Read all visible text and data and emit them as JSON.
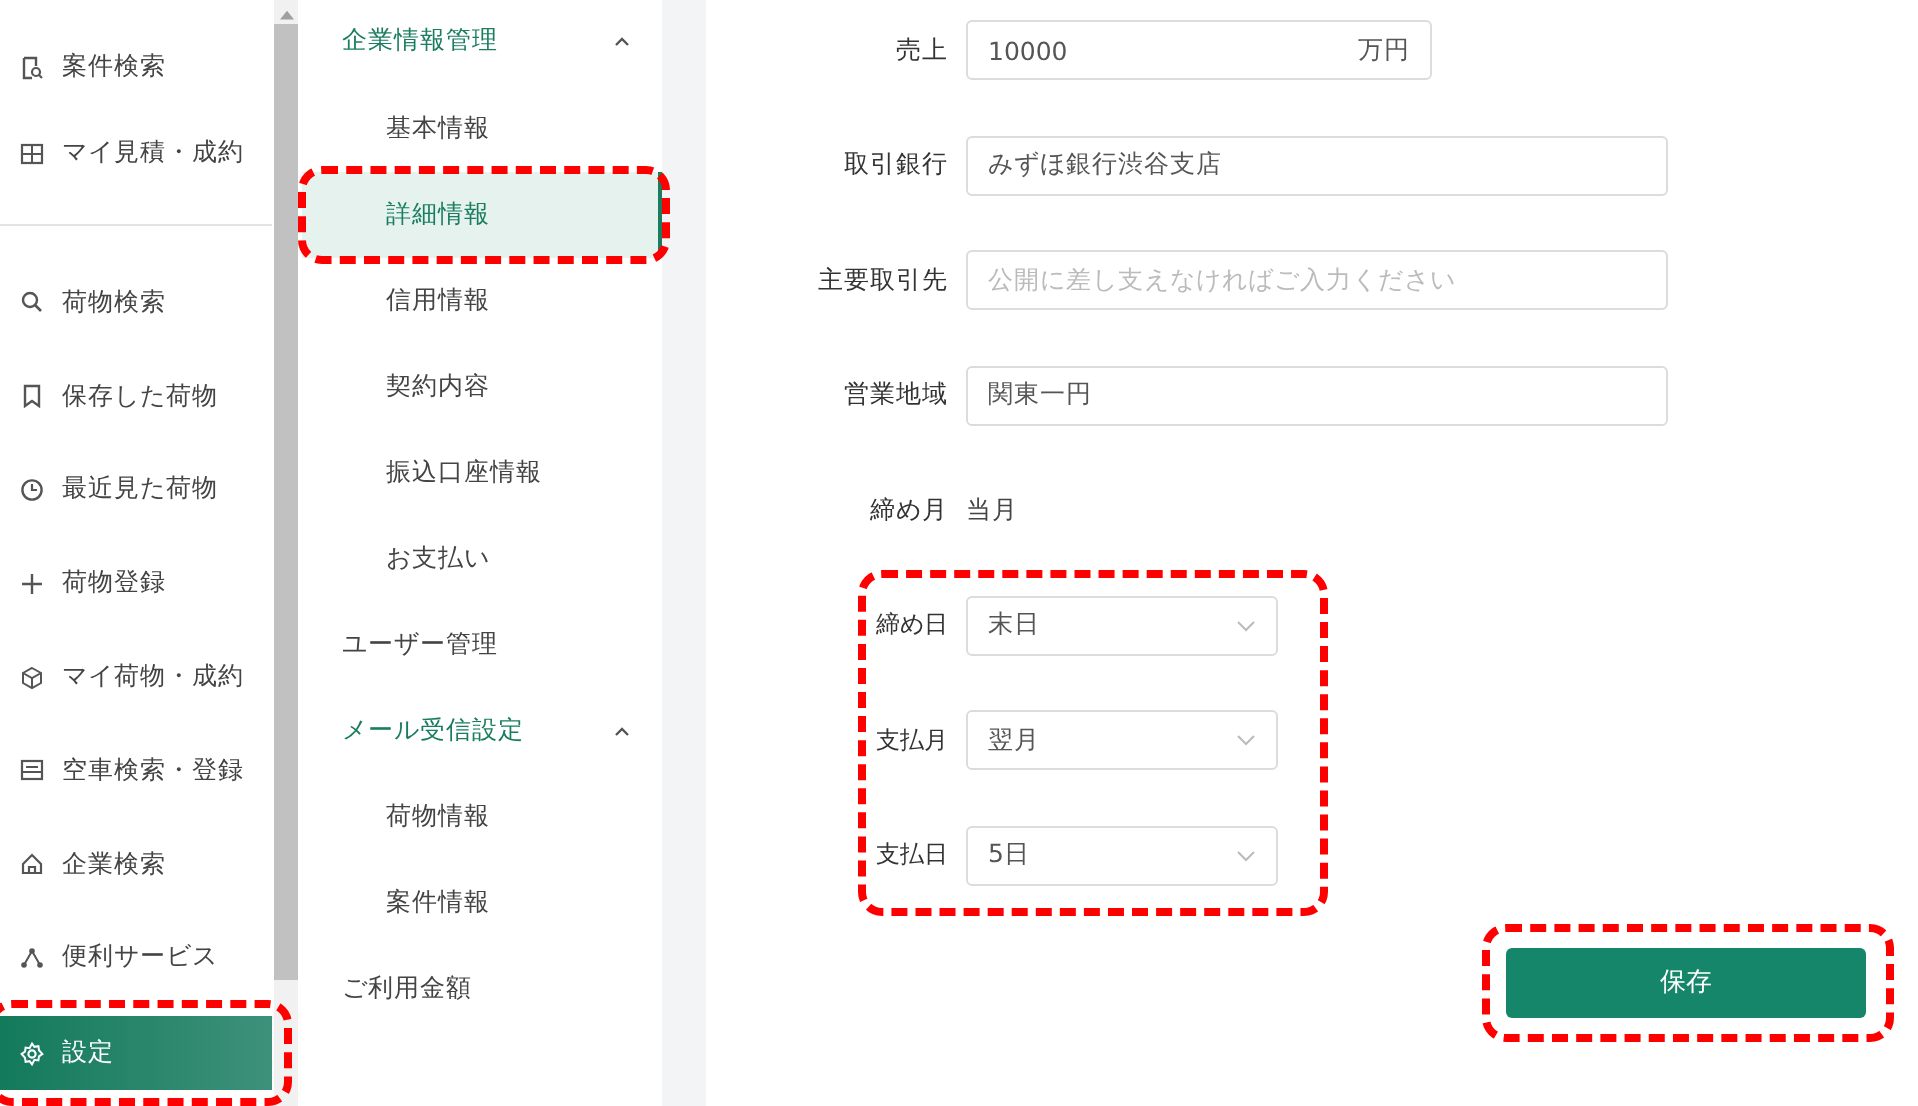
{
  "nav": {
    "groups": [
      {
        "items": [
          {
            "label": "案件検索",
            "selected": false,
            "highlighted": false
          },
          {
            "label": "マイ見積・成約",
            "selected": false,
            "highlighted": false
          }
        ]
      },
      {
        "items": [
          {
            "label": "荷物検索",
            "selected": false,
            "highlighted": false
          },
          {
            "label": "保存した荷物",
            "selected": false,
            "highlighted": false
          },
          {
            "label": "最近見た荷物",
            "selected": false,
            "highlighted": false
          },
          {
            "label": "荷物登録",
            "selected": false,
            "highlighted": false
          },
          {
            "label": "マイ荷物・成約",
            "selected": false,
            "highlighted": false
          },
          {
            "label": "空車検索・登録",
            "selected": false,
            "highlighted": false
          },
          {
            "label": "企業検索",
            "selected": false,
            "highlighted": false
          },
          {
            "label": "便利サービス",
            "selected": false,
            "highlighted": false
          },
          {
            "label": "設定",
            "selected": true,
            "highlighted": true
          }
        ]
      }
    ]
  },
  "submenu": {
    "items": [
      {
        "label": "企業情報管理",
        "expanded": true,
        "children": [
          {
            "label": "基本情報",
            "selected": false,
            "highlighted": false
          },
          {
            "label": "詳細情報",
            "selected": true,
            "highlighted": true
          },
          {
            "label": "信用情報",
            "selected": false,
            "highlighted": false
          },
          {
            "label": "契約内容",
            "selected": false,
            "highlighted": false
          },
          {
            "label": "振込口座情報",
            "selected": false,
            "highlighted": false
          },
          {
            "label": "お支払い",
            "selected": false,
            "highlighted": false
          }
        ]
      },
      {
        "label": "ユーザー管理"
      },
      {
        "label": "メール受信設定",
        "expanded": true,
        "children": [
          {
            "label": "荷物情報",
            "selected": false,
            "highlighted": false
          },
          {
            "label": "案件情報",
            "selected": false,
            "highlighted": false
          }
        ]
      },
      {
        "label": "ご利用金額"
      }
    ]
  },
  "form": {
    "rows": [
      {
        "kind": "amount",
        "label": "売上",
        "value": "10000",
        "unit": "万円"
      },
      {
        "kind": "input",
        "label": "取引銀行",
        "value": "みずほ銀行渋谷支店"
      },
      {
        "kind": "input",
        "label": "主要取引先",
        "placeholder": "公開に差し支えなければご入力ください"
      },
      {
        "kind": "input",
        "label": "営業地域",
        "value": "関東一円"
      },
      {
        "kind": "text",
        "label": "締め月",
        "value": "当月"
      }
    ],
    "payment_group": {
      "highlighted": true,
      "rows": [
        {
          "kind": "select",
          "label": "締め日",
          "value": "末日"
        },
        {
          "kind": "select",
          "label": "支払月",
          "value": "翌月"
        },
        {
          "kind": "select",
          "label": "支払日",
          "value": "5日"
        }
      ]
    },
    "save_button": {
      "label": "保存",
      "highlighted": true
    }
  }
}
